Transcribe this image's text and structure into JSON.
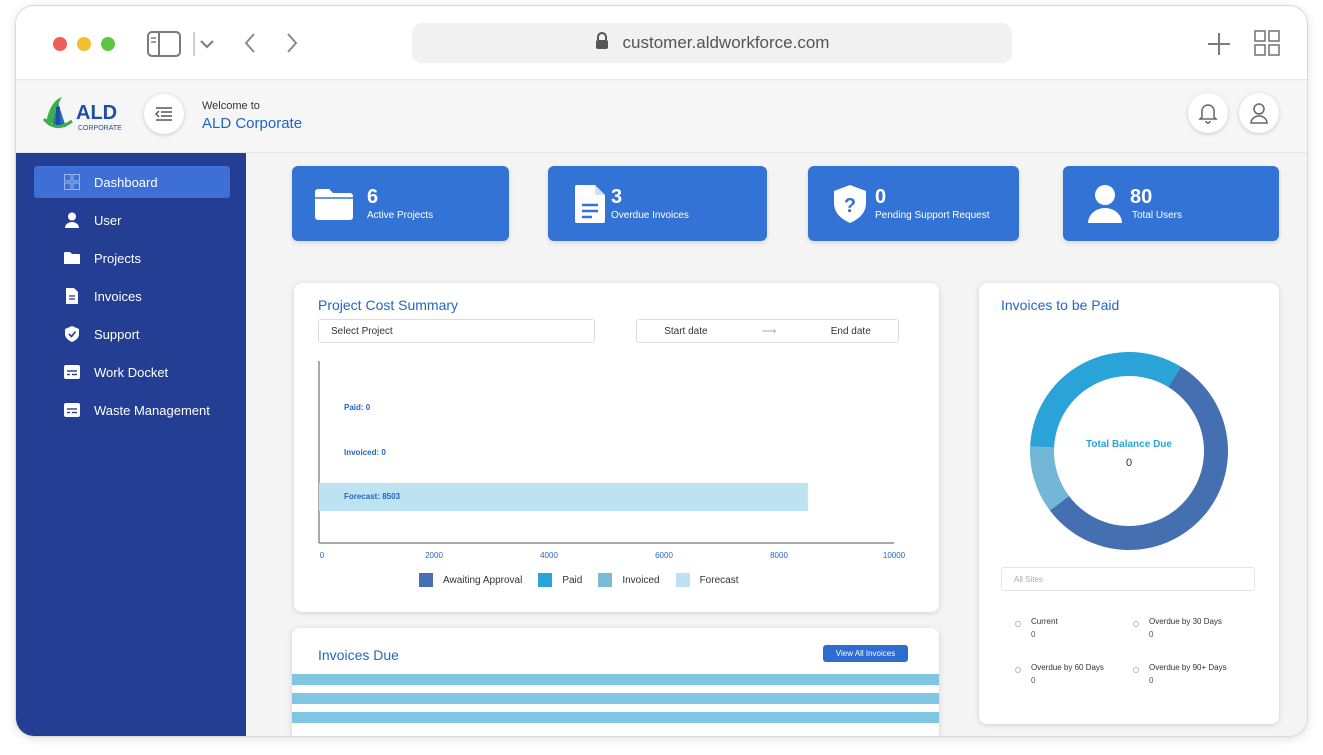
{
  "browser": {
    "url": "customer.aldworkforce.com",
    "traffic_lights": [
      "#ec5f57",
      "#f4bd2e",
      "#5ec53f"
    ]
  },
  "header": {
    "logo_text": "ALD",
    "logo_subtext": "CORPORATE",
    "welcome": "Welcome to",
    "company": "ALD Corporate"
  },
  "sidebar": {
    "items": [
      {
        "label": "Dashboard",
        "icon": "grid-icon",
        "active": true
      },
      {
        "label": "User",
        "icon": "user-icon"
      },
      {
        "label": "Projects",
        "icon": "folder-icon"
      },
      {
        "label": "Invoices",
        "icon": "document-icon"
      },
      {
        "label": "Support",
        "icon": "shield-check-icon"
      },
      {
        "label": "Work Docket",
        "icon": "docket-icon"
      },
      {
        "label": "Waste Management",
        "icon": "docket-icon"
      }
    ]
  },
  "stats": [
    {
      "value": "6",
      "label": "Active Projects",
      "icon": "folder-icon"
    },
    {
      "value": "3",
      "label": "Overdue Invoices",
      "icon": "document-icon"
    },
    {
      "value": "0",
      "label": "Pending Support Request",
      "icon": "question-shield-icon"
    },
    {
      "value": "80",
      "label": "Total Users",
      "icon": "user-icon"
    }
  ],
  "cost_summary": {
    "title": "Project Cost Summary",
    "select_project": "Select Project",
    "start_date": "Start date",
    "end_date": "End date"
  },
  "chart_data": {
    "type": "bar",
    "orientation": "horizontal",
    "categories": [
      "Paid",
      "Invoiced",
      "Forecast"
    ],
    "bar_labels": [
      "Paid: 0",
      "Invoiced: 0",
      "Forecast: 8503"
    ],
    "values": [
      0,
      0,
      8503
    ],
    "xlim": [
      0,
      10000
    ],
    "x_ticks": [
      "0",
      "2000",
      "4000",
      "6000",
      "8000",
      "10000"
    ],
    "legend": [
      {
        "name": "Awaiting Approval",
        "color": "#4770b3"
      },
      {
        "name": "Paid",
        "color": "#2aa3d8"
      },
      {
        "name": "Invoiced",
        "color": "#7bbad8"
      },
      {
        "name": "Forecast",
        "color": "#bde2f1"
      }
    ],
    "legend_position": "bottom"
  },
  "invoices_due": {
    "title": "Invoices Due",
    "view_all": "View All Invoices"
  },
  "invoices_to_pay": {
    "title": "Invoices to be Paid",
    "center_label": "Total Balance Due",
    "center_value": "0",
    "site_filter": "All Sites",
    "donut": [
      {
        "color": "#4470b2",
        "fraction": 0.56
      },
      {
        "color": "#72b6d8",
        "fraction": 0.11
      },
      {
        "color": "#2aa3d8",
        "fraction": 0.33
      }
    ],
    "statuses": [
      {
        "label": "Current",
        "value": "0"
      },
      {
        "label": "Overdue by 30 Days",
        "value": "0"
      },
      {
        "label": "Overdue by 60 Days",
        "value": "0"
      },
      {
        "label": "Overdue by 90+ Days",
        "value": "0"
      }
    ]
  }
}
